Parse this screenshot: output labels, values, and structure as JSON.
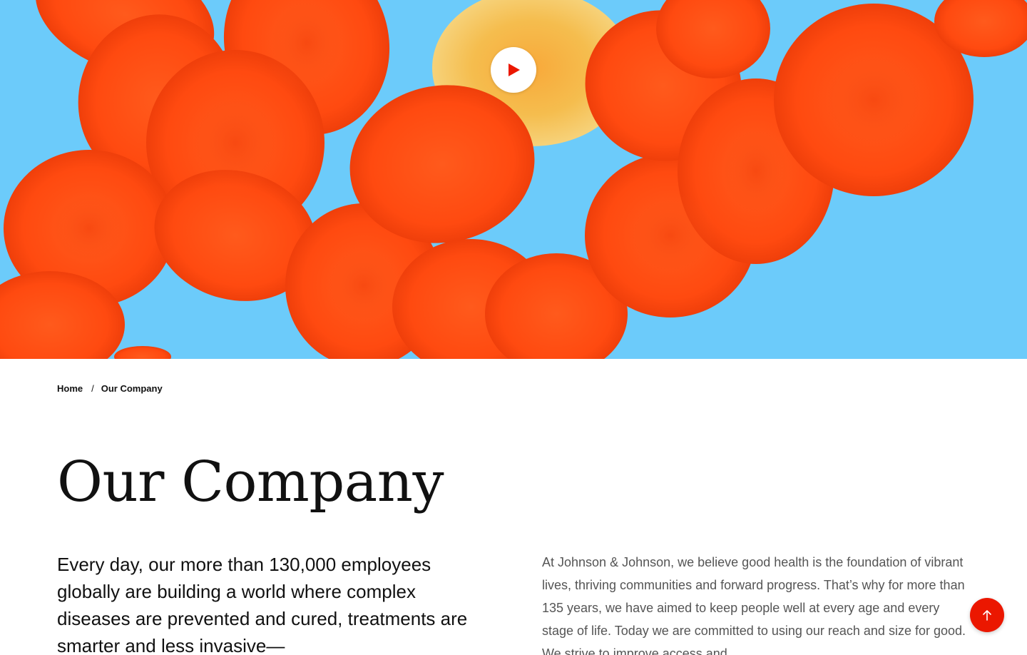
{
  "hero": {
    "background_color": "#6ccbfa",
    "cell_color": "#ff4d14",
    "white_cell_color": "#f4b840",
    "play_icon": "play-icon"
  },
  "breadcrumb": {
    "items": [
      {
        "label": "Home"
      },
      {
        "label": "Our Company"
      }
    ],
    "separator": "/"
  },
  "page": {
    "title": "Our Company",
    "lead": "Every day, our more than 130,000 employees globally are building a world where complex diseases are prevented and cured, treatments are smarter and less invasive—",
    "body": "At Johnson & Johnson, we believe good health is the foundation of vibrant lives, thriving communities and forward progress. That’s why for more than 135 years, we have aimed to keep people well at every age and every stage of life. Today we are committed to using our reach and size for good. We strive to improve access and"
  },
  "scroll_top": {
    "icon": "arrow-up-icon",
    "color": "#eb1700"
  }
}
